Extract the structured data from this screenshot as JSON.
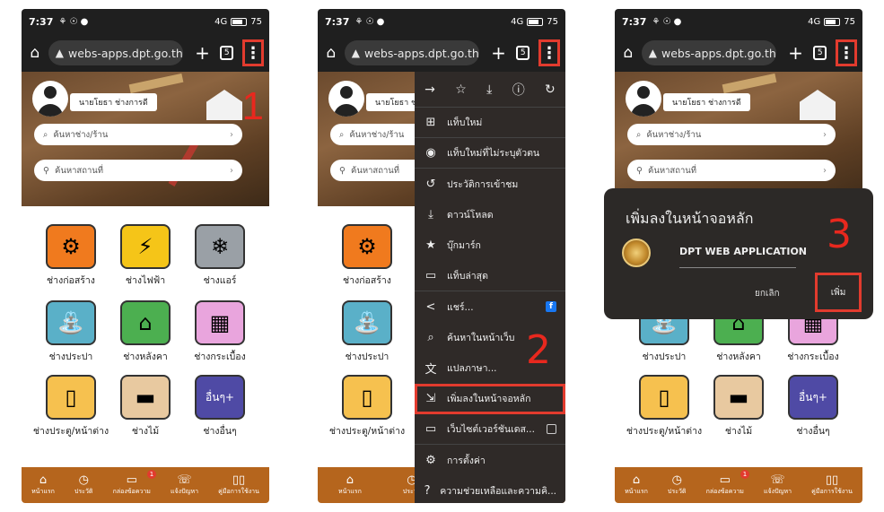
{
  "status": {
    "time": "7:37",
    "icons": "⚘ ☉ ●",
    "signal": "4G",
    "battery": "75"
  },
  "browser": {
    "url": "webs-apps.dpt.go.th/c"
  },
  "profile": {
    "name": "นายโยธา ช่างการดี"
  },
  "search": {
    "store_placeholder": "ค้นหาช่าง/ร้าน",
    "location_placeholder": "ค้นหาสถานที่"
  },
  "services": [
    {
      "label": "ช่างก่อสร้าง",
      "icon": "🛠",
      "bg": "#f07a1e"
    },
    {
      "label": "ช่างไฟฟ้า",
      "icon": "⚡",
      "bg": "#f5c518"
    },
    {
      "label": "ช่างแอร์",
      "icon": "❄",
      "bg": "#9aa0a6"
    },
    {
      "label": "ช่างประปา",
      "icon": "🚰",
      "bg": "#5ab0c8"
    },
    {
      "label": "ช่างหลังคา",
      "icon": "⌂",
      "bg": "#4caf50"
    },
    {
      "label": "ช่างกระเบื้อง",
      "icon": "▦",
      "bg": "#e9a5dd"
    },
    {
      "label": "ช่างประตู/หน้าต่าง",
      "icon": "▯",
      "bg": "#f6c14f"
    },
    {
      "label": "ช่างไม้",
      "icon": "🪵",
      "bg": "#e8c9a0"
    },
    {
      "label": "อื่นๆ+",
      "icon": "",
      "bg": "#4f4aa5"
    }
  ],
  "other_service": {
    "label": "ช่างอื่นๆ",
    "tile_text": "อื่นๆ+"
  },
  "bottom_nav": [
    {
      "label": "หน้าแรก",
      "icon": "🏠"
    },
    {
      "label": "ประวัติ",
      "icon": "⏱"
    },
    {
      "label": "กล่องข้อความ",
      "icon": "💬",
      "badge": "1"
    },
    {
      "label": "แจ้งปัญหา",
      "icon": "☎"
    },
    {
      "label": "คู่มือการใช้งาน",
      "icon": "📖"
    }
  ],
  "menu": {
    "items": [
      {
        "label": "แท็บใหม่",
        "icon": "⊞"
      },
      {
        "label": "แท็บใหม่ที่ไม่ระบุตัวตน",
        "icon": "🕶"
      },
      {
        "label": "ประวัติการเข้าชม",
        "icon": "↺"
      },
      {
        "label": "ดาวน์โหลด",
        "icon": "⤓"
      },
      {
        "label": "บุ๊กมาร์ก",
        "icon": "★"
      },
      {
        "label": "แท็บล่าสุด",
        "icon": "▭"
      },
      {
        "label": "แชร์...",
        "icon": "<"
      },
      {
        "label": "ค้นหาในหน้าเว็บ",
        "icon": "🔍"
      },
      {
        "label": "แปลภาษา...",
        "icon": "文"
      },
      {
        "label": "เพิ่มลงในหน้าจอหลัก",
        "icon": "⇲"
      },
      {
        "label": "เว็บไซต์เวอร์ชันเดส...",
        "icon": "🖥"
      },
      {
        "label": "การตั้งค่า",
        "icon": "⚙"
      },
      {
        "label": "ความช่วยเหลือและความคิ...",
        "icon": "?"
      }
    ]
  },
  "dialog": {
    "title": "เพิ่มลงในหน้าจอหลัก",
    "app_name": "DPT WEB APPLICATION",
    "cancel": "ยกเลิก",
    "add": "เพิ่ม"
  },
  "steps": [
    "1",
    "2",
    "3"
  ]
}
